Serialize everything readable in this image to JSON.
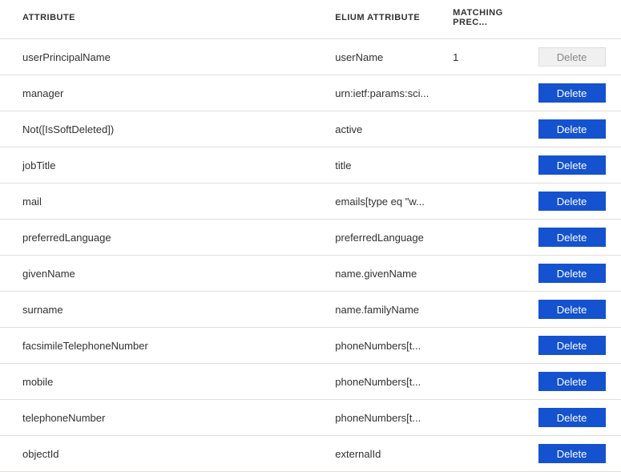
{
  "colors": {
    "primary": "#1452cf",
    "divider": "#e1dfdd",
    "text": "#323130",
    "disabled_bg": "#f0f0f0",
    "disabled_text": "#8a8886"
  },
  "headers": {
    "attribute": "Attribute",
    "elium": "Elium Attribute",
    "matching": "Matching prec..."
  },
  "delete_label": "Delete",
  "rows": [
    {
      "attribute": "userPrincipalName",
      "elium": "userName",
      "matching": "1",
      "enabled": false
    },
    {
      "attribute": "manager",
      "elium": "urn:ietf:params:sci...",
      "matching": "",
      "enabled": true
    },
    {
      "attribute": "Not([IsSoftDeleted])",
      "elium": "active",
      "matching": "",
      "enabled": true
    },
    {
      "attribute": "jobTitle",
      "elium": "title",
      "matching": "",
      "enabled": true
    },
    {
      "attribute": "mail",
      "elium": "emails[type eq \"w...",
      "matching": "",
      "enabled": true
    },
    {
      "attribute": "preferredLanguage",
      "elium": "preferredLanguage",
      "matching": "",
      "enabled": true
    },
    {
      "attribute": "givenName",
      "elium": "name.givenName",
      "matching": "",
      "enabled": true
    },
    {
      "attribute": "surname",
      "elium": "name.familyName",
      "matching": "",
      "enabled": true
    },
    {
      "attribute": "facsimileTelephoneNumber",
      "elium": "phoneNumbers[t...",
      "matching": "",
      "enabled": true
    },
    {
      "attribute": "mobile",
      "elium": "phoneNumbers[t...",
      "matching": "",
      "enabled": true
    },
    {
      "attribute": "telephoneNumber",
      "elium": "phoneNumbers[t...",
      "matching": "",
      "enabled": true
    },
    {
      "attribute": "objectId",
      "elium": "externalId",
      "matching": "",
      "enabled": true
    }
  ]
}
